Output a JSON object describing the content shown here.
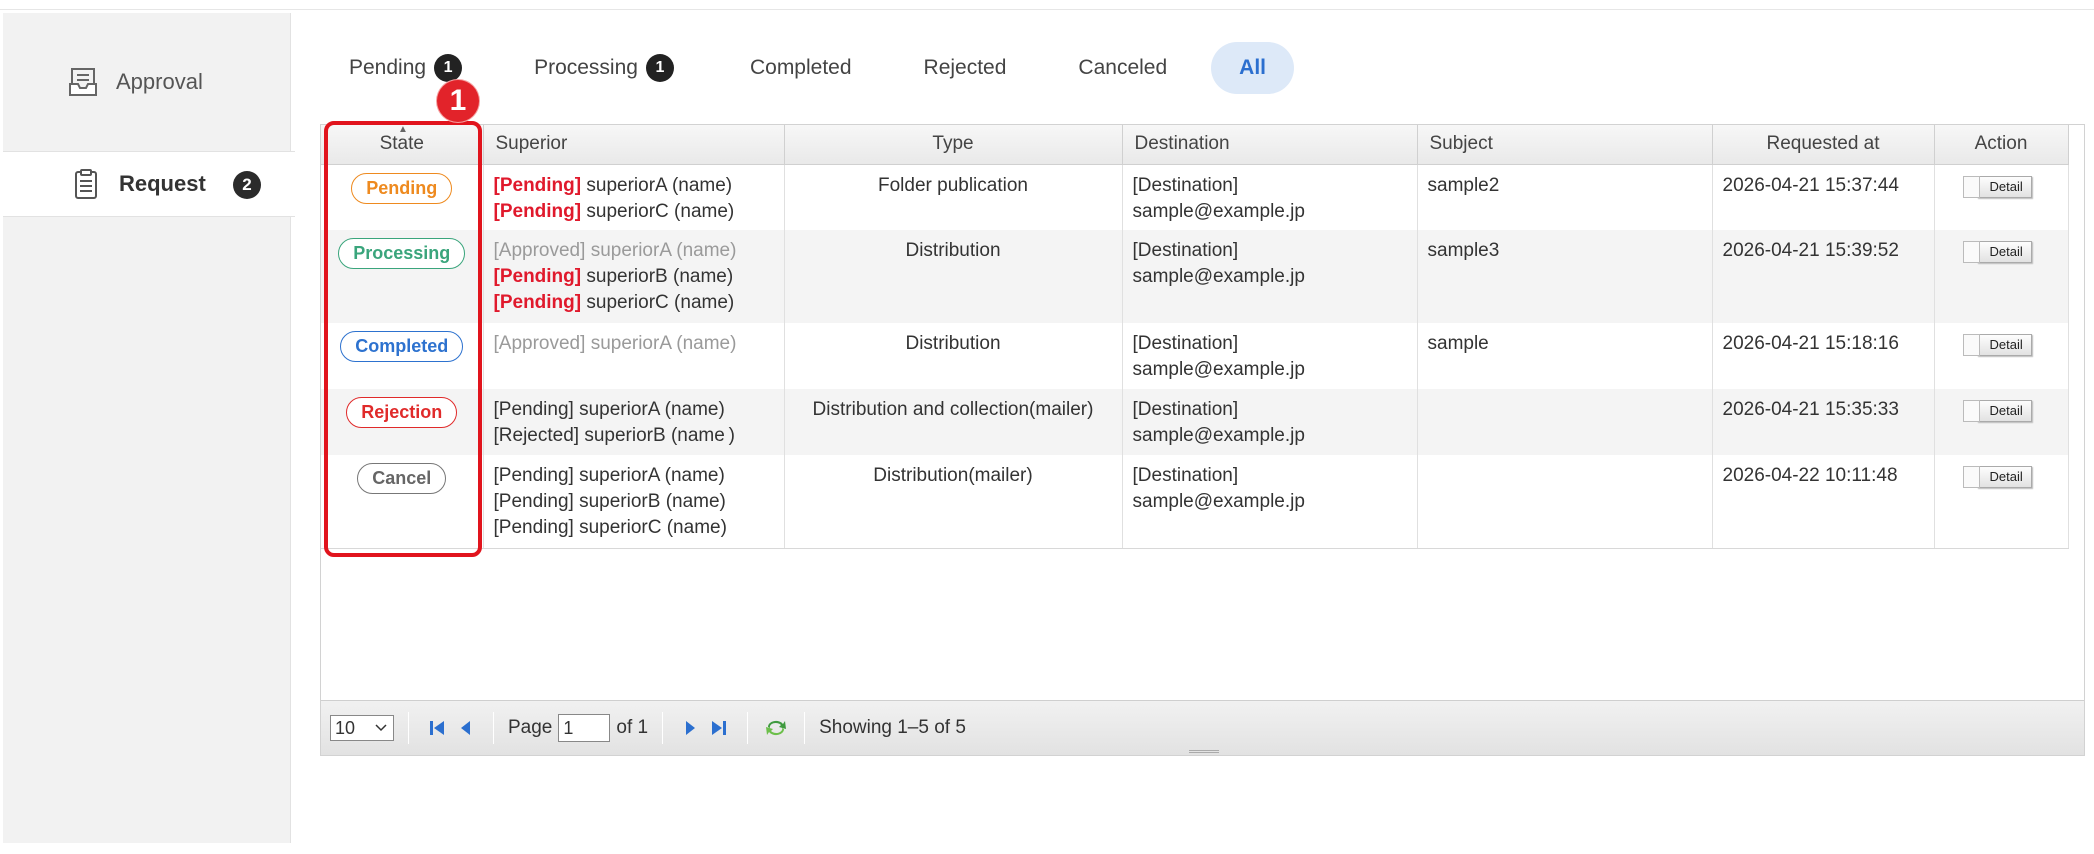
{
  "sidebar": {
    "items": [
      {
        "label": "Approval",
        "icon": "inbox-tray-icon"
      },
      {
        "label": "Request",
        "icon": "clipboard-list-icon",
        "badge": "2"
      }
    ]
  },
  "tabs": [
    {
      "label": "Pending",
      "count": "1"
    },
    {
      "label": "Processing",
      "count": "1"
    },
    {
      "label": "Completed"
    },
    {
      "label": "Rejected"
    },
    {
      "label": "Canceled"
    },
    {
      "label": "All",
      "active": true
    }
  ],
  "grid": {
    "columns": [
      "State",
      "Superior",
      "Type",
      "Destination",
      "Subject",
      "Requested at",
      "Action"
    ],
    "detail_label": "Detail",
    "rows": [
      {
        "state": "Pending",
        "superiors": [
          {
            "tag": "[Pending]",
            "name": "superiorA",
            "paren": "(name)"
          },
          {
            "tag": "[Pending]",
            "name": "superiorC",
            "paren": "(name)"
          }
        ],
        "type": "Folder publication",
        "destination": [
          "[Destination]",
          "sample@example.jp"
        ],
        "subject": "sample2",
        "requested_at": "2026-04-21 15:37:44"
      },
      {
        "state": "Processing",
        "superiors": [
          {
            "tag": "[Approved]",
            "name": "superiorA",
            "paren": "(name)"
          },
          {
            "tag": "[Pending]",
            "name": "superiorB",
            "paren": "(name)"
          },
          {
            "tag": "[Pending]",
            "name": "superiorC",
            "paren": "(name)"
          }
        ],
        "type": "Distribution",
        "destination": [
          "[Destination]",
          "sample@example.jp"
        ],
        "subject": "sample3",
        "requested_at": "2026-04-21 15:39:52"
      },
      {
        "state": "Completed",
        "superiors": [
          {
            "tag": "[Approved]",
            "name": "superiorA",
            "paren": "(name)"
          }
        ],
        "type": "Distribution",
        "destination": [
          "[Destination]",
          "sample@example.jp"
        ],
        "subject": "sample",
        "requested_at": "2026-04-21 15:18:16"
      },
      {
        "state": "Rejection",
        "superiors": [
          {
            "tag": "[Pending]",
            "name": "superiorA",
            "paren": "(name)"
          },
          {
            "tag": "[Rejected]",
            "name": "superiorB",
            "paren": "(name )"
          }
        ],
        "type": "Distribution and collection(mailer)",
        "destination": [
          "[Destination]",
          "sample@example.jp"
        ],
        "subject": "",
        "requested_at": "2026-04-21 15:35:33"
      },
      {
        "state": "Cancel",
        "superiors": [
          {
            "tag": "[Pending]",
            "name": "superiorA",
            "paren": "(name)"
          },
          {
            "tag": "[Pending]",
            "name": "superiorB",
            "paren": "(name)"
          },
          {
            "tag": "[Pending]",
            "name": "superiorC",
            "paren": "(name)"
          }
        ],
        "type": "Distribution(mailer)",
        "destination": [
          "[Destination]",
          "sample@example.jp"
        ],
        "subject": "",
        "requested_at": "2026-04-22 10:11:48"
      }
    ]
  },
  "pager": {
    "page_size": "10",
    "page_label": "Page",
    "page_value": "1",
    "of_label": "of 1",
    "showing": "Showing 1–5 of 5"
  },
  "annotation": {
    "marker": "1"
  },
  "colors": {
    "pending": "#ee8a1f",
    "processing": "#3aa57c",
    "completed": "#2d72cf",
    "rejection": "#e02a2a",
    "cancel": "#666666",
    "highlight": "#e1141d",
    "active_tab_bg": "#dde9f8"
  }
}
